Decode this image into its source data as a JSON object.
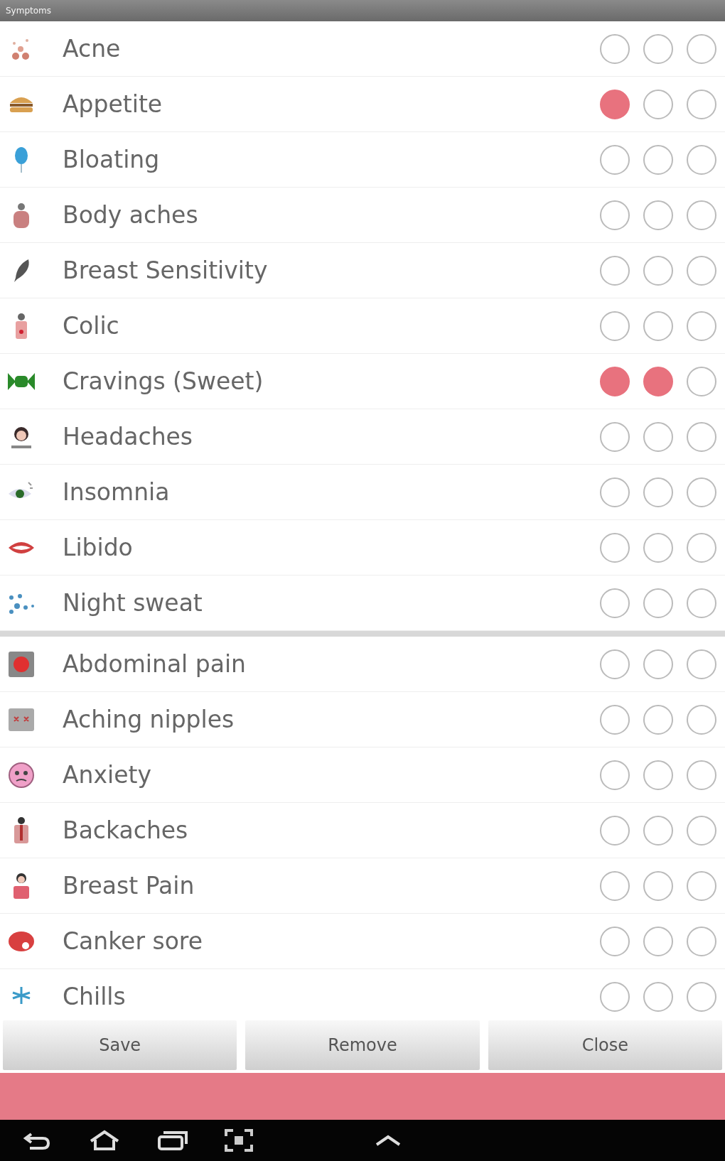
{
  "window": {
    "title": "Symptoms"
  },
  "groups": [
    {
      "rows": [
        {
          "label": "Acne",
          "checked": [
            false,
            false,
            false
          ]
        },
        {
          "label": "Appetite",
          "checked": [
            true,
            false,
            false
          ]
        },
        {
          "label": "Bloating",
          "checked": [
            false,
            false,
            false
          ]
        },
        {
          "label": "Body aches",
          "checked": [
            false,
            false,
            false
          ]
        },
        {
          "label": "Breast Sensitivity",
          "checked": [
            false,
            false,
            false
          ]
        },
        {
          "label": "Colic",
          "checked": [
            false,
            false,
            false
          ]
        },
        {
          "label": "Cravings (Sweet)",
          "checked": [
            true,
            true,
            false
          ]
        },
        {
          "label": "Headaches",
          "checked": [
            false,
            false,
            false
          ]
        },
        {
          "label": "Insomnia",
          "checked": [
            false,
            false,
            false
          ]
        },
        {
          "label": "Libido",
          "checked": [
            false,
            false,
            false
          ]
        },
        {
          "label": "Night sweat",
          "checked": [
            false,
            false,
            false
          ]
        }
      ]
    },
    {
      "rows": [
        {
          "label": "Abdominal pain",
          "checked": [
            false,
            false,
            false
          ]
        },
        {
          "label": "Aching nipples",
          "checked": [
            false,
            false,
            false
          ]
        },
        {
          "label": "Anxiety",
          "checked": [
            false,
            false,
            false
          ]
        },
        {
          "label": "Backaches",
          "checked": [
            false,
            false,
            false
          ]
        },
        {
          "label": "Breast Pain",
          "checked": [
            false,
            false,
            false
          ]
        },
        {
          "label": "Canker sore",
          "checked": [
            false,
            false,
            false
          ]
        },
        {
          "label": "Chills",
          "checked": [
            false,
            false,
            false
          ]
        }
      ]
    }
  ],
  "buttons": [
    "Save",
    "Remove",
    "Close"
  ]
}
